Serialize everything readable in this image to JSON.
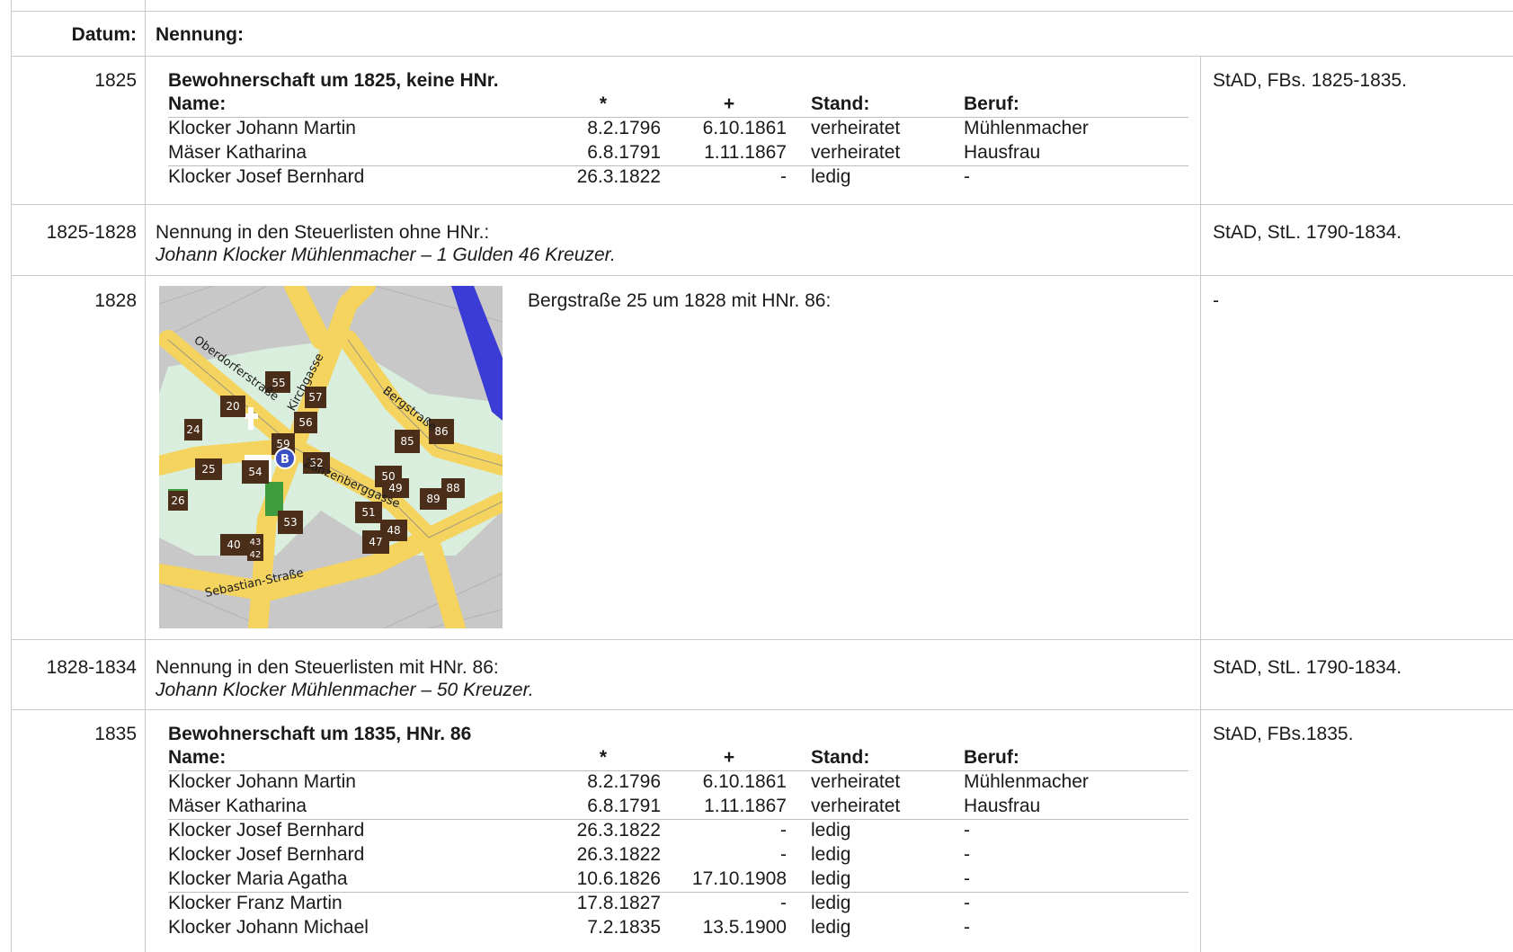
{
  "header": {
    "datum": "Datum:",
    "nennung": "Nennung:"
  },
  "rows": {
    "r1825": {
      "date": "1825",
      "title": "Bewohnerschaft um 1825, keine HNr.",
      "columns": [
        "Name:",
        "*",
        "+",
        "Stand:",
        "Beruf:"
      ],
      "people": [
        [
          "Klocker Johann Martin",
          "8.2.1796",
          "6.10.1861",
          "verheiratet",
          "Mühlenmacher"
        ],
        [
          "Mäser Katharina",
          "6.8.1791",
          "1.11.1867",
          "verheiratet",
          "Hausfrau"
        ],
        [
          "Klocker Josef Bernhard",
          "26.3.1822",
          "-",
          "ledig",
          "-"
        ]
      ],
      "source": "StAD, FBs. 1825-1835."
    },
    "r1825_1828": {
      "date": "1825-1828",
      "line1": "Nennung in den Steuerlisten ohne HNr.:",
      "line2": "Johann Klocker Mühlenmacher – 1 Gulden 46 Kreuzer.",
      "source": "StAD, StL. 1790-1834."
    },
    "r1828": {
      "date": "1828",
      "caption": "Bergstraße 25 um 1828 mit HNr. 86:",
      "source": "-",
      "map": {
        "streets": [
          "Oberdorferstraße",
          "Kirchgasse",
          "Bergstraße",
          "Zanzenberggasse",
          "Sebastian-Straße"
        ],
        "house_numbers": [
          "55",
          "57",
          "20",
          "56",
          "24",
          "59",
          "86",
          "85",
          "52",
          "25",
          "54",
          "50",
          "49",
          "88",
          "89",
          "26",
          "51",
          "53",
          "48",
          "47",
          "40",
          "43",
          "42"
        ],
        "marker": "B"
      }
    },
    "r1828_1834": {
      "date": "1828-1834",
      "line1": "Nennung in den Steuerlisten mit HNr. 86:",
      "line2": "Johann Klocker Mühlenmacher – 50 Kreuzer.",
      "source": "StAD, StL. 1790-1834."
    },
    "r1835": {
      "date": "1835",
      "title": "Bewohnerschaft um 1835, HNr. 86",
      "columns": [
        "Name:",
        "*",
        "+",
        "Stand:",
        "Beruf:"
      ],
      "people": [
        [
          "Klocker Johann Martin",
          "8.2.1796",
          "6.10.1861",
          "verheiratet",
          "Mühlenmacher"
        ],
        [
          "Mäser Katharina",
          "6.8.1791",
          "1.11.1867",
          "verheiratet",
          "Hausfrau"
        ],
        [
          "Klocker Josef Bernhard",
          "26.3.1822",
          "-",
          "ledig",
          "-"
        ],
        [
          "Klocker Josef Bernhard",
          "26.3.1822",
          "-",
          "ledig",
          "-"
        ],
        [
          "Klocker Maria Agatha",
          "10.6.1826",
          "17.10.1908",
          "ledig",
          "-"
        ],
        [
          "Klocker Franz Martin",
          "17.8.1827",
          "-",
          "ledig",
          "-"
        ],
        [
          "Klocker Johann Michael",
          "7.2.1835",
          "13.5.1900",
          "ledig",
          "-"
        ]
      ],
      "source": "StAD, FBs.1835."
    }
  },
  "colors": {
    "grid": "#c9c9c9",
    "map_road": "#f4d35e",
    "map_area": "#d9eedd",
    "map_house": "#4a2e1a",
    "map_river": "#3b3bd6",
    "map_marker": "#3a4fc4"
  }
}
